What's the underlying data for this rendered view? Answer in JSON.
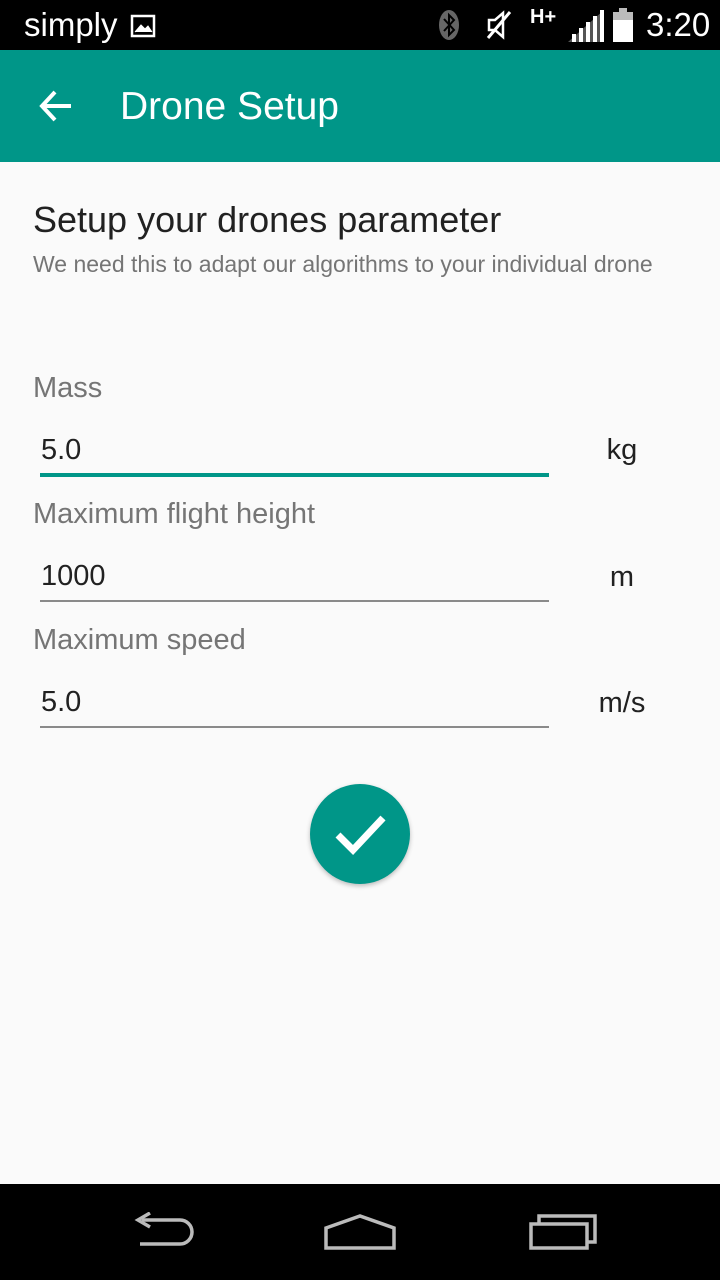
{
  "status_bar": {
    "carrier": "simply",
    "network_type": "H+",
    "time": "3:20",
    "icons": [
      "gallery-icon",
      "bluetooth-icon",
      "mute-icon",
      "signal-icon",
      "battery-icon"
    ]
  },
  "app_bar": {
    "title": "Drone Setup",
    "back_icon": "arrow-back-icon",
    "background_color": "#009688"
  },
  "intro": {
    "heading": "Setup your drones parameter",
    "subheading": "We need this to adapt our algorithms to your individual drone"
  },
  "form": {
    "fields": [
      {
        "label": "Mass",
        "value": "5.0",
        "unit": "kg",
        "focused": true
      },
      {
        "label": "Maximum flight height",
        "value": "1000",
        "unit": "m",
        "focused": false
      },
      {
        "label": "Maximum speed",
        "value": "5.0",
        "unit": "m/s",
        "focused": false
      }
    ],
    "submit_icon": "check-icon"
  },
  "nav_bar": {
    "buttons": [
      "back-icon",
      "home-icon",
      "recents-icon"
    ]
  },
  "colors": {
    "accent": "#009688",
    "text_primary": "#212121",
    "text_secondary": "#757575",
    "background": "#fafafa"
  }
}
